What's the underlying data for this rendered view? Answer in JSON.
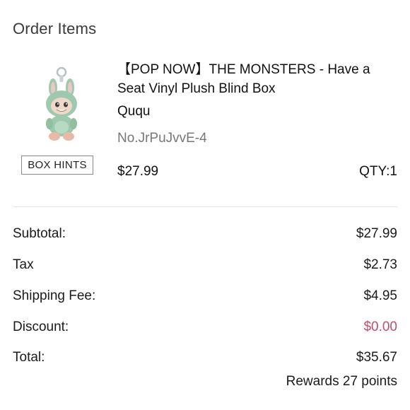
{
  "section": {
    "title": "Order Items"
  },
  "item": {
    "name": "【POP NOW】THE MONSTERS - Have a Seat Vinyl Plush Blind Box",
    "variant": "Ququ",
    "sku": "No.JrPuJvvE-4",
    "price": "$27.99",
    "qty": "QTY:1",
    "box_hints_label": "BOX HINTS",
    "image_icon": "plush-figure-image"
  },
  "summary": {
    "subtotal_label": "Subtotal:",
    "subtotal_value": "$27.99",
    "tax_label": "Tax",
    "tax_value": "$2.73",
    "shipping_label": "Shipping Fee:",
    "shipping_value": "$4.95",
    "discount_label": "Discount:",
    "discount_value": "$0.00",
    "total_label": "Total:",
    "total_value": "$35.67",
    "rewards": "Rewards 27 points"
  },
  "colors": {
    "discount": "#c24d6a",
    "plush_body": "#9fc9ae",
    "text_muted": "#777777"
  }
}
